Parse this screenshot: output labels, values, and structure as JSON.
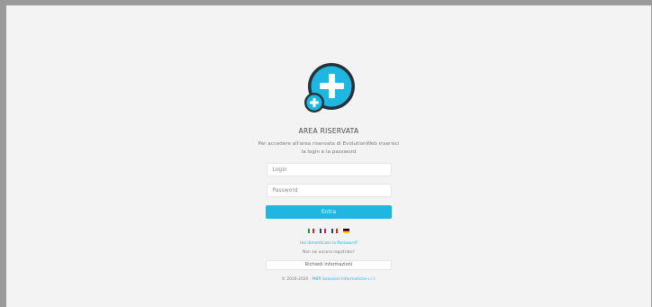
{
  "header": {
    "title": "AREA RISERVATA",
    "description": "Per accedere all'area riservata di EvolutionWeb inserisci la login e la password"
  },
  "form": {
    "login_placeholder": "Login",
    "password_placeholder": "Password",
    "submit_label": "Entra"
  },
  "languages": [
    {
      "name": "italian-flag-icon",
      "colors": [
        "#2f8f3f",
        "#ffffff",
        "#d9252b"
      ]
    },
    {
      "name": "uk-flag-icon",
      "colors": [
        "#2a3a7c",
        "#ffffff",
        "#c8202f"
      ]
    },
    {
      "name": "french-flag-icon",
      "colors": [
        "#23408e",
        "#ffffff",
        "#e1251b"
      ]
    },
    {
      "name": "german-flag-icon",
      "colors": [
        "#111111",
        "#d90012",
        "#ffcc00"
      ]
    }
  ],
  "links": {
    "forgot_password": "Hai dimenticato la Password?",
    "not_registered": "Non sei ancora registrato?",
    "request_info_label": "Richiedi Informazioni"
  },
  "footer": {
    "copyright": "© 2016-2020 - ",
    "company": "MBR Soluzioni Informatiche s.r.l."
  },
  "colors": {
    "accent": "#1fb6df",
    "logo_dark": "#263238"
  }
}
